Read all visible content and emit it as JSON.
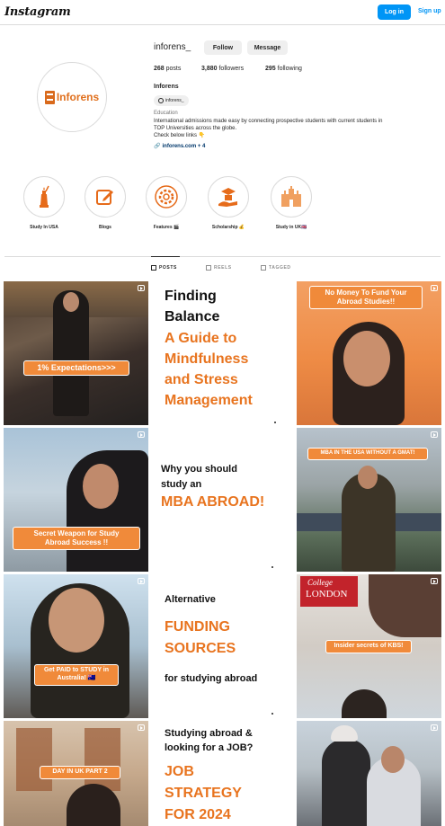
{
  "header": {
    "logo": "Instagram",
    "login_label": "Log in",
    "signup_label": "Sign up"
  },
  "profile": {
    "avatar_text": "Inforens",
    "username": "inforens_",
    "follow_label": "Follow",
    "message_label": "Message",
    "posts_count": "268",
    "posts_label": "posts",
    "followers_count": "3,880",
    "followers_label": "followers",
    "following_count": "295",
    "following_label": "following",
    "full_name": "Inforens",
    "threads_label": "inforens_",
    "category": "Education",
    "bio_line1": "International admissions made easy by connecting prospective students with current students in",
    "bio_line2": "TOP Universities across the globe.",
    "bio_line3": "Check below links 👇",
    "link_text": "inforens.com + 4"
  },
  "highlights": [
    {
      "label": "Study In USA",
      "icon": "statue-of-liberty-icon"
    },
    {
      "label": "Blogs",
      "icon": "edit-icon"
    },
    {
      "label": "Features 🎬",
      "icon": "gear-icon"
    },
    {
      "label": "Scholarship 💰",
      "icon": "scholarship-icon"
    },
    {
      "label": "Study in UK🇬🇧",
      "icon": "castle-icon"
    }
  ],
  "tabs": [
    {
      "label": "POSTS",
      "active": true
    },
    {
      "label": "REELS",
      "active": false
    },
    {
      "label": "TAGGED",
      "active": false
    }
  ],
  "posts": {
    "p1": "1% Expectations>>>",
    "p2_l1": "Finding",
    "p2_l2": "Balance",
    "p2_l3": "A Guide to",
    "p2_l4": "Mindfulness",
    "p2_l5": "and Stress",
    "p2_l6": "Management",
    "p3_l1": "No Money To Fund Your",
    "p3_l2": "Abroad Studies!!",
    "p4_l1": "Secret Weapon for Study",
    "p4_l2": "Abroad Success !!",
    "p5_l1": "Why you should",
    "p5_l2": "study an",
    "p5_l3": "MBA ABROAD!",
    "p6": "MBA IN THE USA WITHOUT A GMAT!",
    "p7_l1": "Get PAID to STUDY in",
    "p7_l2": "Australia! 🇦🇺",
    "p8_l1": "Alternative",
    "p8_l2": "FUNDING",
    "p8_l3": "SOURCES",
    "p8_l4": "for studying abroad",
    "p9_sign1": "College",
    "p9_sign2": "LONDON",
    "p9_caption": "Insider secrets of KBS!",
    "p10": "DAY IN UK PART 2",
    "p11_l1": "Studying abroad &",
    "p11_l2": "looking for a JOB?",
    "p11_l3": "JOB",
    "p11_l4": "STRATEGY",
    "p11_l5": "FOR 2024"
  },
  "colors": {
    "accent": "#e8741f",
    "link_blue": "#0095f6"
  }
}
